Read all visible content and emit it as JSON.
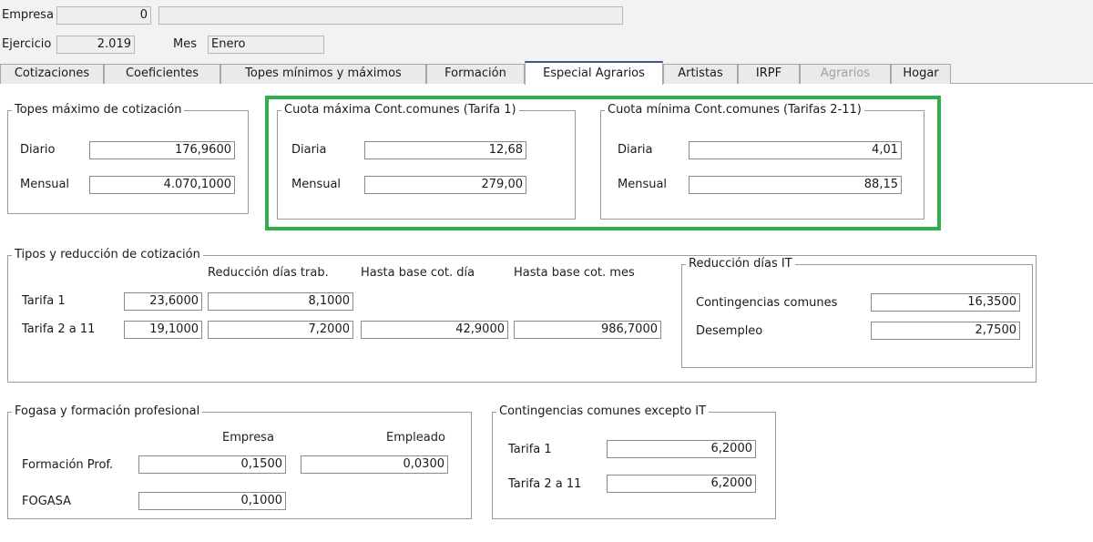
{
  "header": {
    "empresa_label": "Empresa",
    "empresa_code": "0",
    "empresa_name": "",
    "ejercicio_label": "Ejercicio",
    "ejercicio_value": "2.019",
    "mes_label": "Mes",
    "mes_value": "Enero"
  },
  "tabs": [
    {
      "label": "Cotizaciones",
      "active": false
    },
    {
      "label": "Coeficientes",
      "active": false
    },
    {
      "label": "Topes mínimos y máximos",
      "active": false
    },
    {
      "label": "Formación",
      "active": false
    },
    {
      "label": "Especial Agrarios",
      "active": true
    },
    {
      "label": "Artistas",
      "active": false
    },
    {
      "label": "IRPF",
      "active": false
    },
    {
      "label": "Agrarios",
      "active": false,
      "disabled": true
    },
    {
      "label": "Hogar",
      "active": false
    }
  ],
  "topes": {
    "title": "Topes máximo de cotización",
    "diario_label": "Diario",
    "diario_value": "176,9600",
    "mensual_label": "Mensual",
    "mensual_value": "4.070,1000"
  },
  "cuota_maxima": {
    "title": "Cuota máxima Cont.comunes (Tarifa 1)",
    "diaria_label": "Diaria",
    "diaria_value": "12,68",
    "mensual_label": "Mensual",
    "mensual_value": "279,00"
  },
  "cuota_minima": {
    "title": "Cuota mínima Cont.comunes (Tarifas 2-11)",
    "diaria_label": "Diaria",
    "diaria_value": "4,01",
    "mensual_label": "Mensual",
    "mensual_value": "88,15"
  },
  "tipos": {
    "title": "Tipos y reducción de cotización",
    "col_reduccion": "Reducción días trab.",
    "col_hasta_dia": "Hasta base cot. día",
    "col_hasta_mes": "Hasta base cot. mes",
    "rows": [
      {
        "label": "Tarifa 1",
        "tipo": "23,6000",
        "reduccion": "8,1000",
        "hasta_dia": "",
        "hasta_mes": ""
      },
      {
        "label": "Tarifa 2 a 11",
        "tipo": "19,1000",
        "reduccion": "7,2000",
        "hasta_dia": "42,9000",
        "hasta_mes": "986,7000"
      }
    ]
  },
  "reduccion_it": {
    "title": "Reducción días IT",
    "contingencias_label": "Contingencias comunes",
    "contingencias_value": "16,3500",
    "desempleo_label": "Desempleo",
    "desempleo_value": "2,7500"
  },
  "fogasa": {
    "title": "Fogasa y formación profesional",
    "col_empresa": "Empresa",
    "col_empleado": "Empleado",
    "formacion_label": "Formación Prof.",
    "formacion_empresa": "0,1500",
    "formacion_empleado": "0,0300",
    "fogasa_label": "FOGASA",
    "fogasa_empresa": "0,1000"
  },
  "contingencias_it": {
    "title": "Contingencias comunes excepto IT",
    "tarifa1_label": "Tarifa 1",
    "tarifa1_value": "6,2000",
    "tarifa2_label": "Tarifa 2 a 11",
    "tarifa2_value": "6,2000"
  },
  "colors": {
    "highlight": "#2fae4a",
    "active_tab_accent": "#3a5a8c"
  }
}
